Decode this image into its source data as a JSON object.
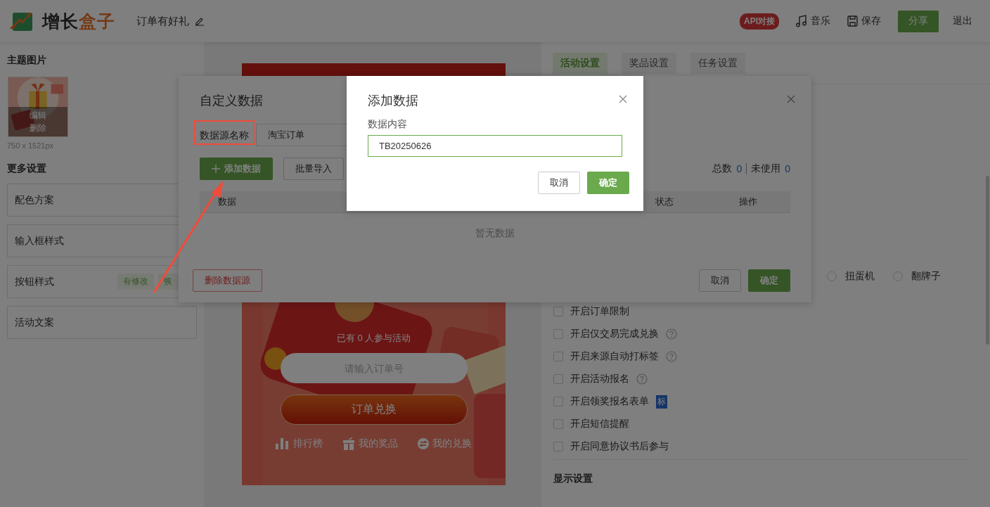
{
  "header": {
    "logo": [
      "增长",
      "盒子"
    ],
    "title": "订单有好礼",
    "api_badge": "API对接",
    "actions": [
      {
        "kind": "music",
        "label": "音乐"
      },
      {
        "kind": "save",
        "label": "保存"
      }
    ],
    "share_button": "分享",
    "exit_link": "退出"
  },
  "sidebar": {
    "theme_heading": "主题图片",
    "thumbnail": {
      "kind": "picture",
      "actions": [
        "编辑",
        "删除"
      ]
    },
    "size": "750 x 1521px",
    "more_heading": "更多设置",
    "items": [
      {
        "label": "配色方案"
      },
      {
        "label": "输入框样式"
      },
      {
        "label": "按钮样式",
        "tags": [
          "有修改",
          "恢"
        ]
      },
      {
        "label": "活动文案"
      }
    ]
  },
  "preview": {
    "participants": "已有 0 人参与活动",
    "order_field": {
      "placeholder": "请输入订单号"
    },
    "redeem_button": "订单兑换",
    "links": [
      {
        "kind": "rank",
        "label": "排行榜"
      },
      {
        "kind": "gift",
        "label": "我的奖品"
      },
      {
        "kind": "exchange",
        "label": "我的兑换"
      }
    ]
  },
  "settings": {
    "tabs": [
      {
        "label": "活动设置",
        "selected": true
      },
      {
        "label": "奖品设置",
        "selected": false
      },
      {
        "label": "任务设置",
        "selected": false
      }
    ],
    "modes": [
      {
        "label": "扭蛋机",
        "selected": false
      },
      {
        "label": "翻牌子",
        "selected": false
      }
    ],
    "options": [
      {
        "label": "开启订单限制",
        "checked": false,
        "help": false
      },
      {
        "label": "开启仅交易完成兑换",
        "checked": false,
        "help": true
      },
      {
        "label": "开启来源自动打标签",
        "checked": false,
        "help": true
      },
      {
        "label": "开启活动报名",
        "checked": false,
        "help": true
      },
      {
        "label": "开启领奖报名表单",
        "checked": false,
        "help": false,
        "tag": "标"
      },
      {
        "label": "开启短信提醒",
        "checked": false,
        "help": false
      },
      {
        "label": "开启同意协议书后参与",
        "checked": false,
        "help": false
      }
    ],
    "display_heading": "显示设置"
  },
  "custom_data_dialog": {
    "title": "自定义数据",
    "source_label": "数据源名称",
    "source_name": "淘宝订单",
    "add_button": "添加数据",
    "import_button": "批量导入",
    "total_label": "总数",
    "total": "0",
    "unused_label": "未使用",
    "unused": "0",
    "columns": [
      "数据",
      "状态",
      "操作"
    ],
    "empty": "暂无数据",
    "delete_button": "删除数据源",
    "cancel_button": "取消",
    "confirm_button": "确定"
  },
  "add_data_dialog": {
    "title": "添加数据",
    "field_label": "数据内容",
    "field_value": "TB20250626",
    "cancel_button": "取消",
    "confirm_button": "确定"
  }
}
